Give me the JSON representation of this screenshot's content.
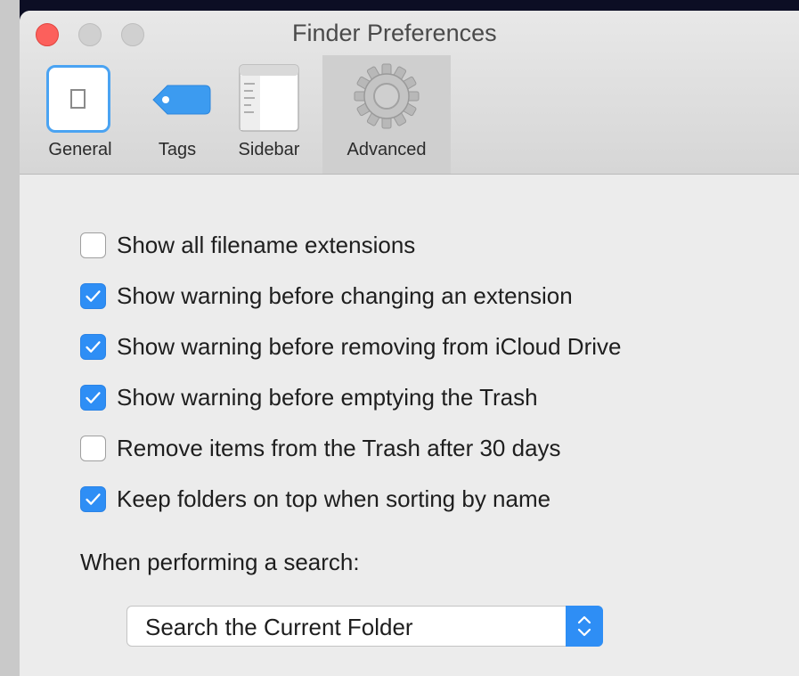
{
  "window": {
    "title": "Finder Preferences"
  },
  "tabs": [
    {
      "label": "General",
      "icon": "general-icon"
    },
    {
      "label": "Tags",
      "icon": "tag-icon"
    },
    {
      "label": "Sidebar",
      "icon": "sidebar-icon"
    },
    {
      "label": "Advanced",
      "icon": "gear-icon",
      "selected": true
    }
  ],
  "options": [
    {
      "label": "Show all filename extensions",
      "checked": false
    },
    {
      "label": "Show warning before changing an extension",
      "checked": true
    },
    {
      "label": "Show warning before removing from iCloud Drive",
      "checked": true
    },
    {
      "label": "Show warning before emptying the Trash",
      "checked": true
    },
    {
      "label": "Remove items from the Trash after 30 days",
      "checked": false
    },
    {
      "label": "Keep folders on top when sorting by name",
      "checked": true
    }
  ],
  "search": {
    "label": "When performing a search:",
    "selected": "Search the Current Folder"
  },
  "colors": {
    "accent": "#2e8ef5",
    "close": "#fc605c"
  }
}
